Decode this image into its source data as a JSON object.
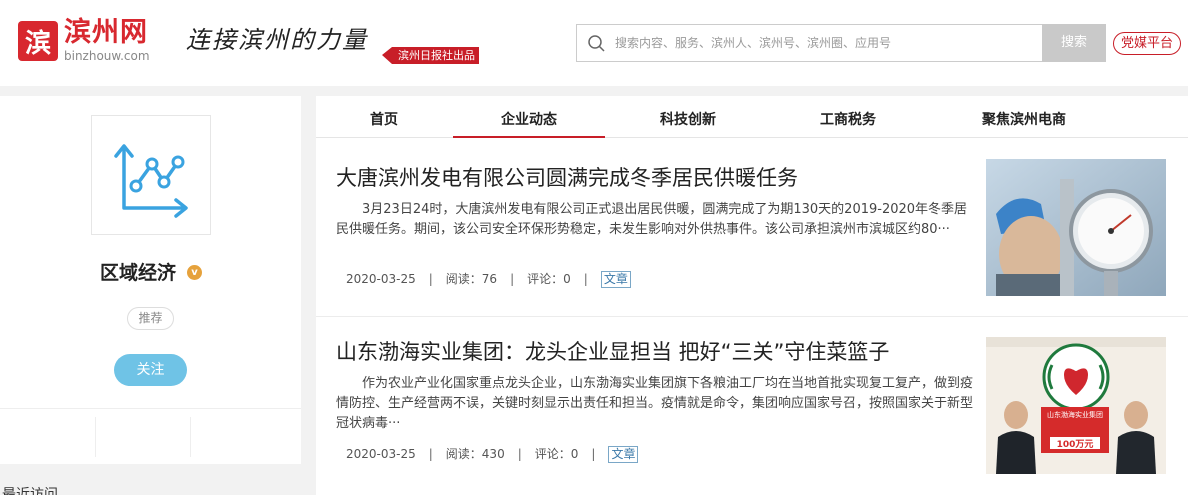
{
  "header": {
    "logo_mark": "滨",
    "logo_text": "滨州网",
    "logo_domain": "binzhouw.com",
    "slogan": "连接滨州的力量",
    "publisher": "滨州日报社出品",
    "search": {
      "placeholder": "搜索内容、服务、滨州人、滨州号、滨州圈、应用号",
      "button": "搜索"
    },
    "party_button": "党媒平台"
  },
  "sidebar": {
    "channel_name": "区域经济",
    "verified_badge": "v",
    "tag": "推荐",
    "follow": "关注",
    "recent_title": "最近访问"
  },
  "tabs": [
    {
      "label": "首页",
      "active": false
    },
    {
      "label": "企业动态",
      "active": true
    },
    {
      "label": "科技创新",
      "active": false
    },
    {
      "label": "工商税务",
      "active": false
    },
    {
      "label": "聚焦滨州电商",
      "active": false
    }
  ],
  "articles": [
    {
      "title": "大唐滨州发电有限公司圆满完成冬季居民供暖任务",
      "summary": "3月23日24时，大唐滨州发电有限公司正式退出居民供暖，圆满完成了为期130天的2019-2020年冬季居民供暖任务。期间，该公司安全环保形势稳定，未发生影响对外供热事件。该公司承担滨州市滨城区约80···",
      "date": "2020-03-25",
      "reads": "阅读：76",
      "comments": "评论：0",
      "type": "文章"
    },
    {
      "title": "山东渤海实业集团：龙头企业显担当 把好“三关”守住菜篮子",
      "summary": "作为农业产业化国家重点龙头企业，山东渤海实业集团旗下各粮油工厂均在当地首批实现复工复产，做到疫情防控、生产经营两不误，关键时刻显示出责任和担当。疫情就是命令，集团响应国家号召，按照国家关于新型冠状病毒···",
      "date": "2020-03-25",
      "reads": "阅读：430",
      "comments": "评论：0",
      "type": "文章",
      "image_text": {
        "board_line1": "山东渤海实业集团",
        "amount": "100万元"
      }
    }
  ],
  "colors": {
    "brand_red": "#c81e28",
    "follow_blue": "#6fc3e6"
  }
}
